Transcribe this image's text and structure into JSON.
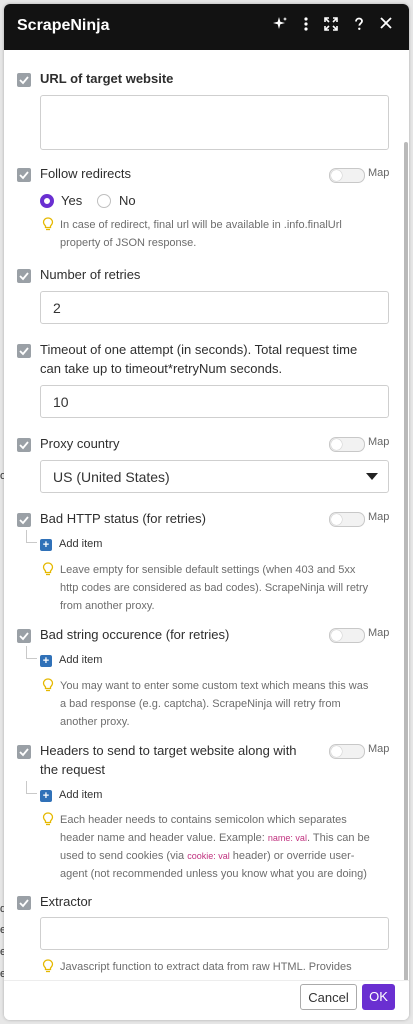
{
  "header": {
    "title": "ScrapeNinja"
  },
  "background_fragments": [
    "o",
    "q",
    "e",
    "e",
    "e"
  ],
  "toggle_label": "Map",
  "fields": {
    "url": {
      "label": "URL of target website",
      "value": ""
    },
    "follow_redirects": {
      "label": "Follow redirects",
      "options": [
        "Yes",
        "No"
      ],
      "selected": "Yes",
      "hint_line1": "In case of redirect, final url will be available in .info.finalUrl",
      "hint_line2": "property of JSON response."
    },
    "retries": {
      "label": "Number of retries",
      "value": "2"
    },
    "timeout": {
      "label_line1": "Timeout of one attempt (in seconds). Total request time",
      "label_line2": "can take up to timeout*retryNum seconds.",
      "value": "10"
    },
    "proxy": {
      "label": "Proxy country",
      "value": "US (United States)"
    },
    "bad_status": {
      "label": "Bad HTTP status (for retries)",
      "add_label": "Add item",
      "hint_line1": "Leave empty for sensible default settings (when 403 and 5xx",
      "hint_line2": "http codes are considered as bad codes). ScrapeNinja will retry",
      "hint_line3": "from another proxy."
    },
    "bad_string": {
      "label": "Bad string occurence (for retries)",
      "add_label": "Add item",
      "hint_line1": "You may want to enter some custom text which means this was",
      "hint_line2": "a bad response (e.g. captcha). ScrapeNinja will retry from",
      "hint_line3": "another proxy."
    },
    "headers": {
      "label_line1": "Headers to send to target website along with",
      "label_line2": "the request",
      "add_label": "Add item",
      "hint_line1": "Each header needs to contains semicolon which separates",
      "hint_line2a": "header name and header value. Example: ",
      "hint_code1": "name: val",
      "hint_line2b": ". This can be",
      "hint_line3a": "used to send cookies (via ",
      "hint_code2": "cookie: val",
      "hint_line3b": " header) or override user-",
      "hint_line4": "agent (not recommended unless you know what you are doing)"
    },
    "extractor": {
      "label": "Extractor",
      "value": "",
      "hint_line1": "Javascript function to extract data from raw HTML. Provides"
    }
  },
  "footer": {
    "cancel_label": "Cancel",
    "ok_label": "OK"
  }
}
